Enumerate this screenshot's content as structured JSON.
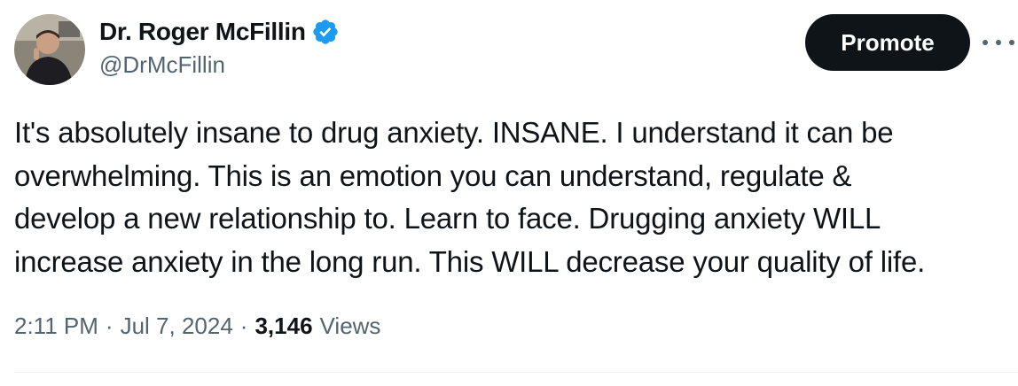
{
  "author": {
    "display_name": "Dr. Roger McFillin",
    "handle": "@DrMcFillin",
    "verified": true
  },
  "actions": {
    "promote_label": "Promote",
    "more_icon": "more-horizontal-icon"
  },
  "tweet": {
    "text": "It's absolutely insane to drug anxiety. INSANE. I understand it can be\noverwhelming. This is an emotion you can understand, regulate &\ndevelop a new relationship to. Learn to face.  Drugging anxiety WILL\nincrease anxiety in the long run. This WILL decrease your quality of life."
  },
  "meta": {
    "time": "2:11 PM",
    "separator": "·",
    "date": "Jul 7, 2024",
    "views_count": "3,146",
    "views_label": "Views"
  },
  "colors": {
    "text_primary": "#0f1419",
    "text_secondary": "#536471",
    "verified_blue": "#1d9bf0",
    "button_bg": "#0f1419"
  }
}
